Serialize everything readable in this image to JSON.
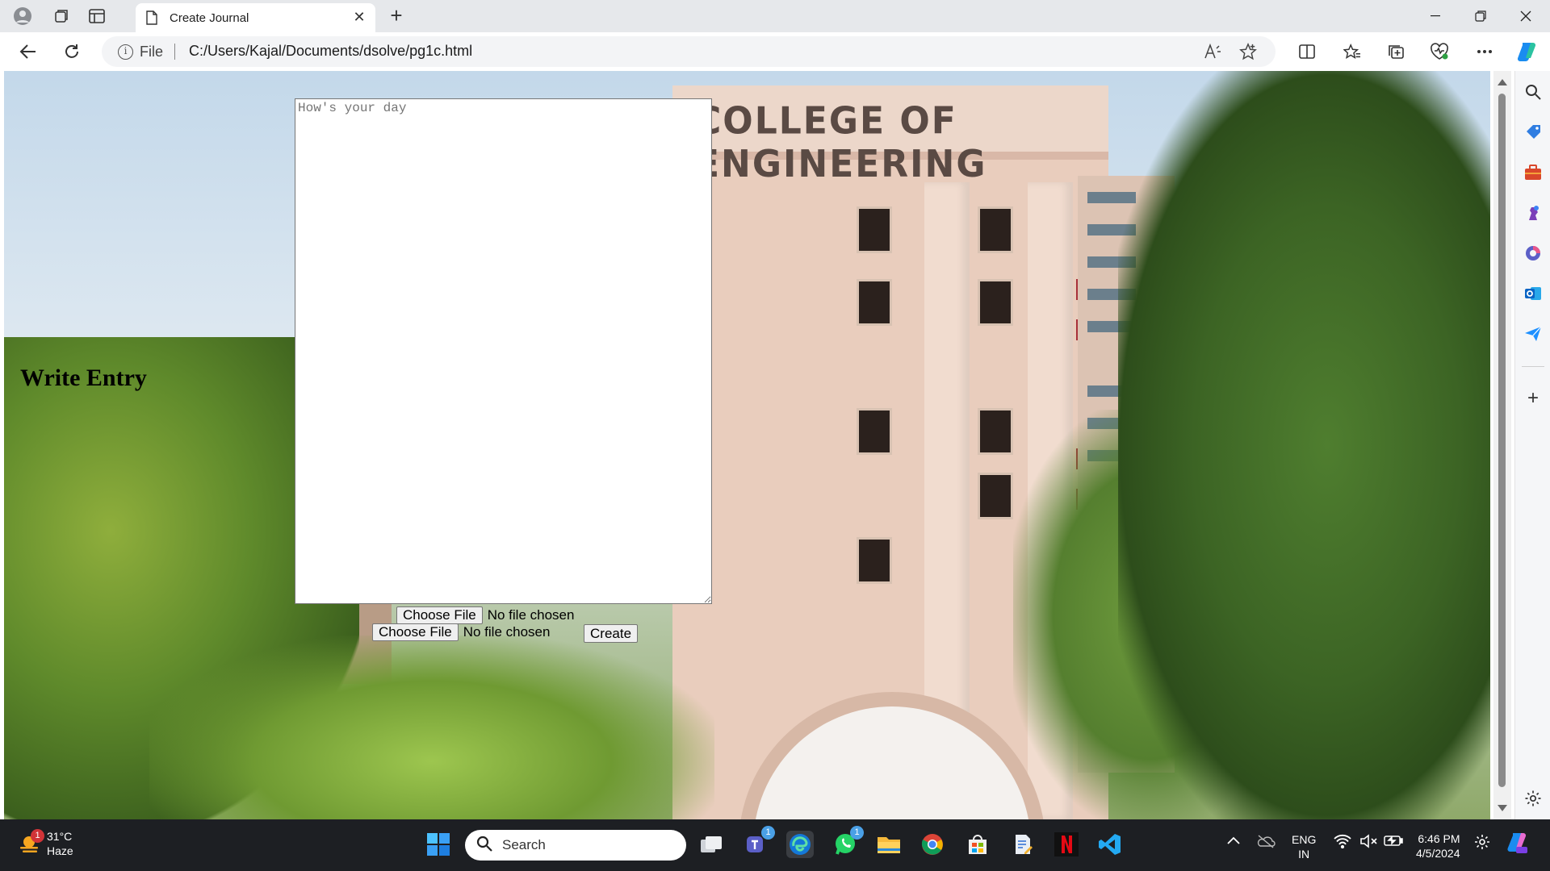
{
  "browser": {
    "tab_title": "Create Journal",
    "site_info_label": "File",
    "url": "C:/Users/Kajal/Documents/dsolve/pg1c.html"
  },
  "page": {
    "heading": "Write Entry",
    "textarea_placeholder": "How's your day",
    "file_inputs": [
      {
        "button_label": "Choose File",
        "status": "No file chosen"
      },
      {
        "button_label": "Choose File",
        "status": "No file chosen"
      }
    ],
    "create_label": "Create",
    "background_sign": "COLLEGE OF ENGINEERING"
  },
  "taskbar": {
    "weather_temp": "31°C",
    "weather_desc": "Haze",
    "weather_badge": "1",
    "search_placeholder": "Search",
    "teams_badge": "1",
    "whatsapp_badge": "1",
    "lang_line1": "ENG",
    "lang_line2": "IN",
    "time": "6:46 PM",
    "date": "4/5/2024"
  },
  "colors": {
    "accent": "#0078d4",
    "taskbar_bg": "#1d1f23",
    "tab_bar_bg": "#e6e8eb"
  },
  "icons": [
    "profile-icon",
    "workspaces-icon",
    "vertical-tabs-icon",
    "page-icon",
    "close-icon",
    "new-tab-icon",
    "minimize-icon",
    "restore-icon",
    "window-close-icon",
    "back-icon",
    "refresh-icon",
    "info-icon",
    "read-aloud-icon",
    "favorite-star-icon",
    "split-screen-icon",
    "favorites-icon",
    "collections-icon",
    "browser-essentials-icon",
    "more-icon",
    "copilot-icon",
    "search-icon",
    "shopping-icon",
    "tools-icon",
    "games-icon",
    "m365-icon",
    "outlook-icon",
    "send-icon",
    "add-icon",
    "settings-icon",
    "windows-start-icon",
    "task-view-icon",
    "teams-icon",
    "edge-icon",
    "whatsapp-icon",
    "file-explorer-icon",
    "chrome-icon",
    "store-icon",
    "notepad-icon",
    "netflix-icon",
    "vscode-icon",
    "chevron-up-icon",
    "onedrive-icon",
    "wifi-icon",
    "speaker-muted-icon",
    "battery-icon",
    "sync-icon",
    "copilot-taskbar-icon"
  ]
}
